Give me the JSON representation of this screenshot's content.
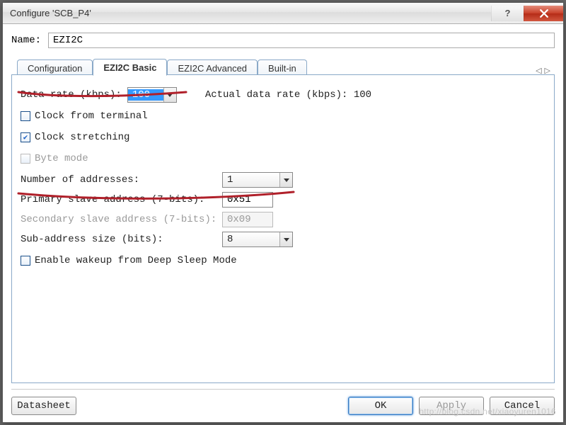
{
  "window": {
    "title": "Configure 'SCB_P4'",
    "help_icon": "?",
    "close_icon": "close-x"
  },
  "name": {
    "label": "Name:",
    "value": "EZI2C"
  },
  "tabs": [
    "Configuration",
    "EZI2C Basic",
    "EZI2C Advanced",
    "Built-in"
  ],
  "active_tab_index": 1,
  "tab_arrows": {
    "left": "◁",
    "right": "▷"
  },
  "form": {
    "data_rate_label": "Data rate (kbps):",
    "data_rate_value": "100",
    "actual_rate_label": "Actual data rate (kbps): 100",
    "clock_from_terminal": {
      "label": "Clock from terminal",
      "checked": false
    },
    "clock_stretching": {
      "label": "Clock stretching",
      "checked": true
    },
    "byte_mode": {
      "label": "Byte mode",
      "checked": false,
      "disabled": true
    },
    "num_addr_label": "Number of addresses:",
    "num_addr_value": "1",
    "primary_label": "Primary slave address (7-bits):",
    "primary_value": "0x51",
    "secondary_label": "Secondary slave address (7-bits):",
    "secondary_value": "0x09",
    "subaddr_label": "Sub-address size (bits):",
    "subaddr_value": "8",
    "deep_sleep": {
      "label": "Enable wakeup from Deep Sleep Mode",
      "checked": false
    }
  },
  "buttons": {
    "datasheet": "Datasheet",
    "ok": "OK",
    "apply": "Apply",
    "cancel": "Cancel"
  },
  "watermark": "http://blog.csdn.net/xiaoyuren1016",
  "annotation_color": "#b0202a"
}
